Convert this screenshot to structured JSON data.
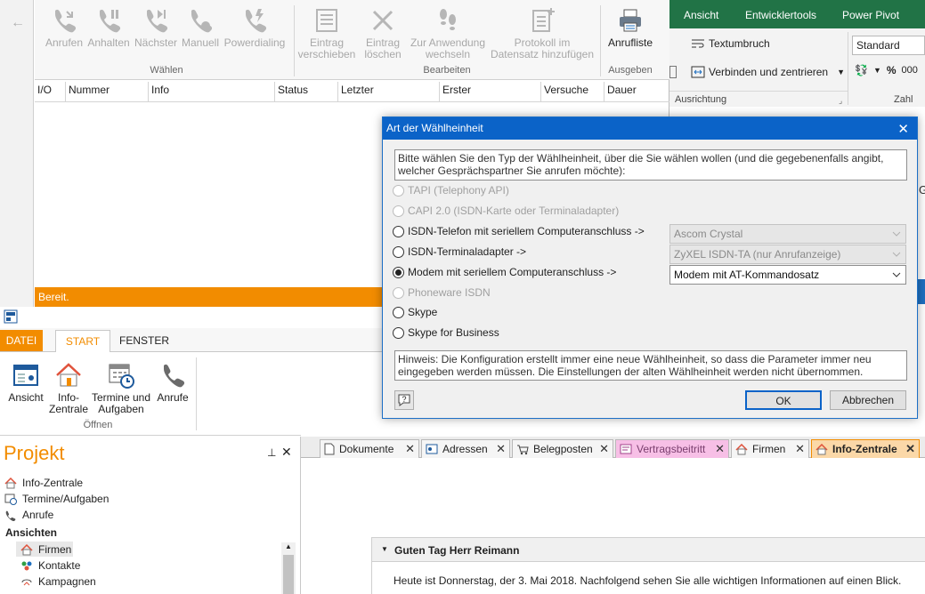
{
  "dialer": {
    "buttons": [
      {
        "label": "Anrufen",
        "icon": "phone-call-icon"
      },
      {
        "label": "Anhalten",
        "icon": "phone-pause-icon"
      },
      {
        "label": "Nächster",
        "icon": "phone-next-icon"
      },
      {
        "label": "Manuell",
        "icon": "phone-manual-icon"
      },
      {
        "label": "Powerdialing",
        "icon": "phone-power-icon"
      },
      {
        "label": "Eintrag\nverschieben",
        "icon": "move-entry-icon"
      },
      {
        "label": "Eintrag\nlöschen",
        "icon": "delete-entry-icon"
      },
      {
        "label": "Zur Anwendung\nwechseln",
        "icon": "switch-app-icon"
      },
      {
        "label": "Protokoll im\nDatensatz hinzufügen",
        "icon": "add-protocol-icon"
      },
      {
        "label": "Anrufliste",
        "icon": "print-icon"
      }
    ],
    "groups": {
      "waehlen": "Wählen",
      "bearbeiten": "Bearbeiten",
      "ausgeben": "Ausgeben"
    },
    "columns": [
      "I/O",
      "Nummer",
      "Info",
      "Status",
      "Letzter",
      "Erster",
      "Versuche",
      "Dauer"
    ],
    "status": "Bereit."
  },
  "excel": {
    "tabs": [
      "Ansicht",
      "Entwicklertools",
      "Power Pivot"
    ],
    "textumbruch": "Textumbruch",
    "verbinden": "Verbinden und zentrieren",
    "format": "Standard",
    "percent": "%",
    "thousands": "000",
    "ausrichtung": "Ausrichtung",
    "zahl": "Zahl",
    "cellfrag": "G"
  },
  "dialog": {
    "title": "Art der Wählheinheit",
    "intro": "Bitte wählen Sie den Typ der Wählheinheit, über die Sie wählen wollen (und die gegebenenfalls angibt, welcher Gesprächspartner Sie anrufen möchte):",
    "options": [
      {
        "label": "TAPI (Telephony API)",
        "enabled": false,
        "selected": false
      },
      {
        "label": "CAPI 2.0 (ISDN-Karte oder Terminaladapter)",
        "enabled": false,
        "selected": false
      },
      {
        "label": "ISDN-Telefon mit seriellem Computeranschluss ->",
        "enabled": true,
        "selected": false
      },
      {
        "label": "ISDN-Terminaladapter ->",
        "enabled": true,
        "selected": false
      },
      {
        "label": "Modem mit seriellem Computeranschluss ->",
        "enabled": true,
        "selected": true
      },
      {
        "label": "Phoneware ISDN",
        "enabled": false,
        "selected": false
      },
      {
        "label": "Skype",
        "enabled": true,
        "selected": false
      },
      {
        "label": "Skype for Business",
        "enabled": true,
        "selected": false
      }
    ],
    "selects": [
      {
        "value": "Ascom Crystal",
        "enabled": false
      },
      {
        "value": "ZyXEL ISDN-TA (nur Anrufanzeige)",
        "enabled": false
      },
      {
        "value": "Modem mit AT-Kommandosatz",
        "enabled": true
      }
    ],
    "hint": "Hinweis: Die Konfiguration erstellt immer eine neue Wählheinheit, so dass die Parameter immer neu eingegeben werden müssen. Die Einstellungen der alten Wählheinheit werden nicht übernommen.",
    "ok": "OK",
    "cancel": "Abbrechen",
    "close": "✕"
  },
  "app": {
    "tabs": {
      "datei": "DATEI",
      "start": "START",
      "fenster": "FENSTER"
    },
    "buttons": [
      {
        "label": "Ansicht",
        "icon": "view-icon"
      },
      {
        "label": "Info-\nZentrale",
        "icon": "home-icon"
      },
      {
        "label": "Termine und\nAufgaben",
        "icon": "calendar-clock-icon"
      },
      {
        "label": "Anrufe",
        "icon": "phone-icon"
      }
    ],
    "group": "Öffnen",
    "panel": {
      "title": "Projekt",
      "items": [
        "Info-Zentrale",
        "Termine/Aufgaben",
        "Anrufe"
      ],
      "section": "Ansichten",
      "views": [
        "Firmen",
        "Kontakte",
        "Kampagnen"
      ]
    },
    "doctabs": [
      "Dokumente",
      "Adressen",
      "Belegposten",
      "Vertragsbeitritt",
      "Firmen",
      "Info-Zentrale"
    ],
    "greeting": "Guten Tag Herr Reimann",
    "today": "Heute ist Donnerstag, der 3. Mai 2018. Nachfolgend sehen Sie alle wichtigen Informationen auf einen Blick."
  },
  "colors": {
    "accent": "#f28c00",
    "excel_green": "#217346",
    "dialog_title": "#0b63c8",
    "vertrag_tab": "#f7bfe6"
  }
}
